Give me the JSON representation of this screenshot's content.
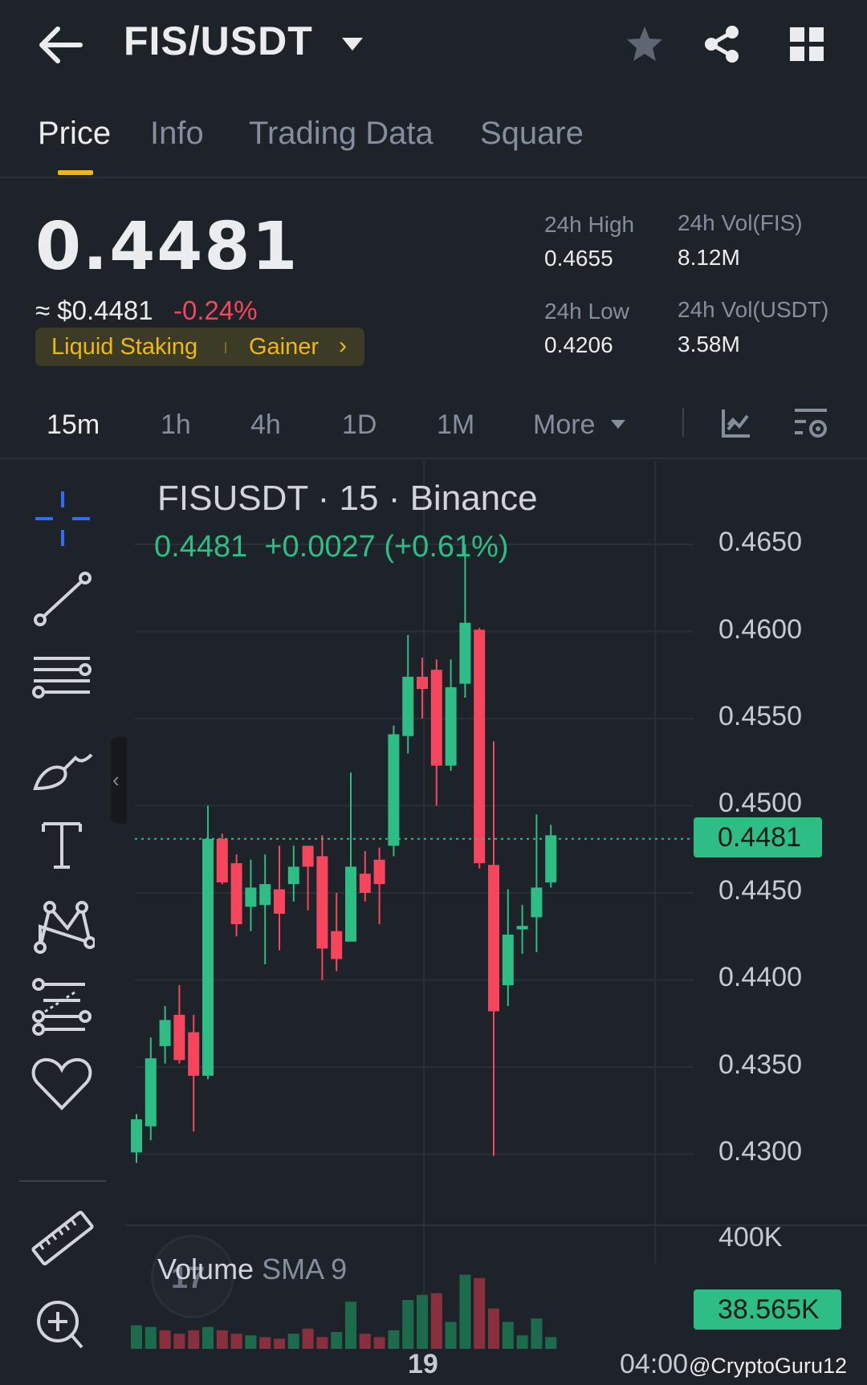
{
  "header": {
    "pair": "FIS/USDT",
    "icons": [
      "back-arrow-icon",
      "caret-down-icon",
      "star-icon",
      "share-icon",
      "grid-icon"
    ]
  },
  "tabs": [
    {
      "label": "Price",
      "active": true
    },
    {
      "label": "Info"
    },
    {
      "label": "Trading Data"
    },
    {
      "label": "Square"
    }
  ],
  "summary": {
    "last_price": "0.4481",
    "usd_approx": "≈ $0.4481",
    "change_pct": "-0.24%",
    "tags": [
      "Liquid Staking",
      "Gainer"
    ],
    "high_label": "24h High",
    "high_value": "0.4655",
    "low_label": "24h Low",
    "low_value": "0.4206",
    "vol_base_label": "24h Vol(FIS)",
    "vol_base_value": "8.12M",
    "vol_quote_label": "24h Vol(USDT)",
    "vol_quote_value": "3.58M"
  },
  "intervals": [
    {
      "label": "15m",
      "active": true
    },
    {
      "label": "1h"
    },
    {
      "label": "4h"
    },
    {
      "label": "1D"
    },
    {
      "label": "1M"
    },
    {
      "label": "More"
    }
  ],
  "toolbar": [
    "crosshair-icon",
    "trendline-icon",
    "horizontal-lines-icon",
    "brush-icon",
    "text-icon",
    "pattern-icon",
    "fib-icon",
    "heart-icon",
    "ruler-icon",
    "zoom-in-icon"
  ],
  "chart": {
    "title": "FISUSDT · 15 · Binance",
    "ohlc_price": "0.4481",
    "ohlc_change": "+0.0027 (+0.61%)",
    "current_price_tag": "0.4481",
    "volume_label": "Volume",
    "volume_sma": "SMA 9",
    "volume_axis_label": "400K",
    "volume_tag": "38.565K",
    "x_labels": [
      "19",
      "04:00"
    ],
    "watermark": "@CryptoGuru12",
    "up_color": "#2ebd85",
    "down_color": "#f6465d"
  },
  "chart_data": {
    "type": "candlestick",
    "title": "FISUSDT · 15 · Binance",
    "y_ticks": [
      "0.4650",
      "0.4600",
      "0.4550",
      "0.4500",
      "0.4450",
      "0.4400",
      "0.4350",
      "0.4300"
    ],
    "ylim": [
      0.4272,
      0.4692
    ],
    "x_labels": [
      "19",
      "04:00"
    ],
    "current_price": 0.4481,
    "candles": [
      {
        "o": 0.4301,
        "h": 0.4323,
        "l": 0.4295,
        "c": 0.432
      },
      {
        "o": 0.4316,
        "h": 0.4367,
        "l": 0.4308,
        "c": 0.4355
      },
      {
        "o": 0.4362,
        "h": 0.4385,
        "l": 0.4352,
        "c": 0.4377
      },
      {
        "o": 0.438,
        "h": 0.4397,
        "l": 0.4352,
        "c": 0.4354
      },
      {
        "o": 0.437,
        "h": 0.438,
        "l": 0.4313,
        "c": 0.4345
      },
      {
        "o": 0.4345,
        "h": 0.45,
        "l": 0.4343,
        "c": 0.4481
      },
      {
        "o": 0.4481,
        "h": 0.4484,
        "l": 0.4455,
        "c": 0.4456
      },
      {
        "o": 0.4467,
        "h": 0.4472,
        "l": 0.4425,
        "c": 0.4432
      },
      {
        "o": 0.4442,
        "h": 0.4469,
        "l": 0.4428,
        "c": 0.4453
      },
      {
        "o": 0.4443,
        "h": 0.4472,
        "l": 0.4409,
        "c": 0.4455
      },
      {
        "o": 0.4452,
        "h": 0.4477,
        "l": 0.4417,
        "c": 0.4438
      },
      {
        "o": 0.4455,
        "h": 0.4477,
        "l": 0.4445,
        "c": 0.4465
      },
      {
        "o": 0.4477,
        "h": 0.4476,
        "l": 0.444,
        "c": 0.4465
      },
      {
        "o": 0.4471,
        "h": 0.4483,
        "l": 0.44,
        "c": 0.4418
      },
      {
        "o": 0.4428,
        "h": 0.445,
        "l": 0.4405,
        "c": 0.4412
      },
      {
        "o": 0.4422,
        "h": 0.4519,
        "l": 0.4422,
        "c": 0.4465
      },
      {
        "o": 0.4461,
        "h": 0.4474,
        "l": 0.4445,
        "c": 0.445
      },
      {
        "o": 0.4469,
        "h": 0.4476,
        "l": 0.4432,
        "c": 0.4455
      },
      {
        "o": 0.4477,
        "h": 0.4546,
        "l": 0.4471,
        "c": 0.4541
      },
      {
        "o": 0.454,
        "h": 0.4598,
        "l": 0.453,
        "c": 0.4574
      },
      {
        "o": 0.4574,
        "h": 0.4585,
        "l": 0.455,
        "c": 0.4567
      },
      {
        "o": 0.4578,
        "h": 0.4584,
        "l": 0.45,
        "c": 0.4523
      },
      {
        "o": 0.4523,
        "h": 0.4584,
        "l": 0.452,
        "c": 0.4568
      },
      {
        "o": 0.457,
        "h": 0.465,
        "l": 0.4562,
        "c": 0.4605
      },
      {
        "o": 0.4601,
        "h": 0.4602,
        "l": 0.4464,
        "c": 0.4467
      },
      {
        "o": 0.4466,
        "h": 0.4537,
        "l": 0.4299,
        "c": 0.4382
      },
      {
        "o": 0.4397,
        "h": 0.4452,
        "l": 0.4385,
        "c": 0.4426
      },
      {
        "o": 0.4429,
        "h": 0.4443,
        "l": 0.4415,
        "c": 0.4431
      },
      {
        "o": 0.4436,
        "h": 0.4495,
        "l": 0.4416,
        "c": 0.4453
      },
      {
        "o": 0.4456,
        "h": 0.4489,
        "l": 0.4453,
        "c": 0.4483
      }
    ],
    "volume": [
      {
        "v": 14,
        "up": true
      },
      {
        "v": 13,
        "up": true
      },
      {
        "v": 11,
        "up": false
      },
      {
        "v": 9,
        "up": false
      },
      {
        "v": 11,
        "up": false
      },
      {
        "v": 13,
        "up": true
      },
      {
        "v": 11,
        "up": false
      },
      {
        "v": 9,
        "up": false
      },
      {
        "v": 8,
        "up": true
      },
      {
        "v": 7,
        "up": false
      },
      {
        "v": 6,
        "up": false
      },
      {
        "v": 9,
        "up": true
      },
      {
        "v": 12,
        "up": false
      },
      {
        "v": 7,
        "up": false
      },
      {
        "v": 10,
        "up": true
      },
      {
        "v": 28,
        "up": true
      },
      {
        "v": 9,
        "up": false
      },
      {
        "v": 7,
        "up": false
      },
      {
        "v": 11,
        "up": true
      },
      {
        "v": 29,
        "up": true
      },
      {
        "v": 32,
        "up": true
      },
      {
        "v": 33,
        "up": false
      },
      {
        "v": 16,
        "up": true
      },
      {
        "v": 44,
        "up": true
      },
      {
        "v": 42,
        "up": false
      },
      {
        "v": 24,
        "up": false
      },
      {
        "v": 16,
        "up": true
      },
      {
        "v": 8,
        "up": true
      },
      {
        "v": 18,
        "up": true
      },
      {
        "v": 7,
        "up": true
      }
    ]
  }
}
